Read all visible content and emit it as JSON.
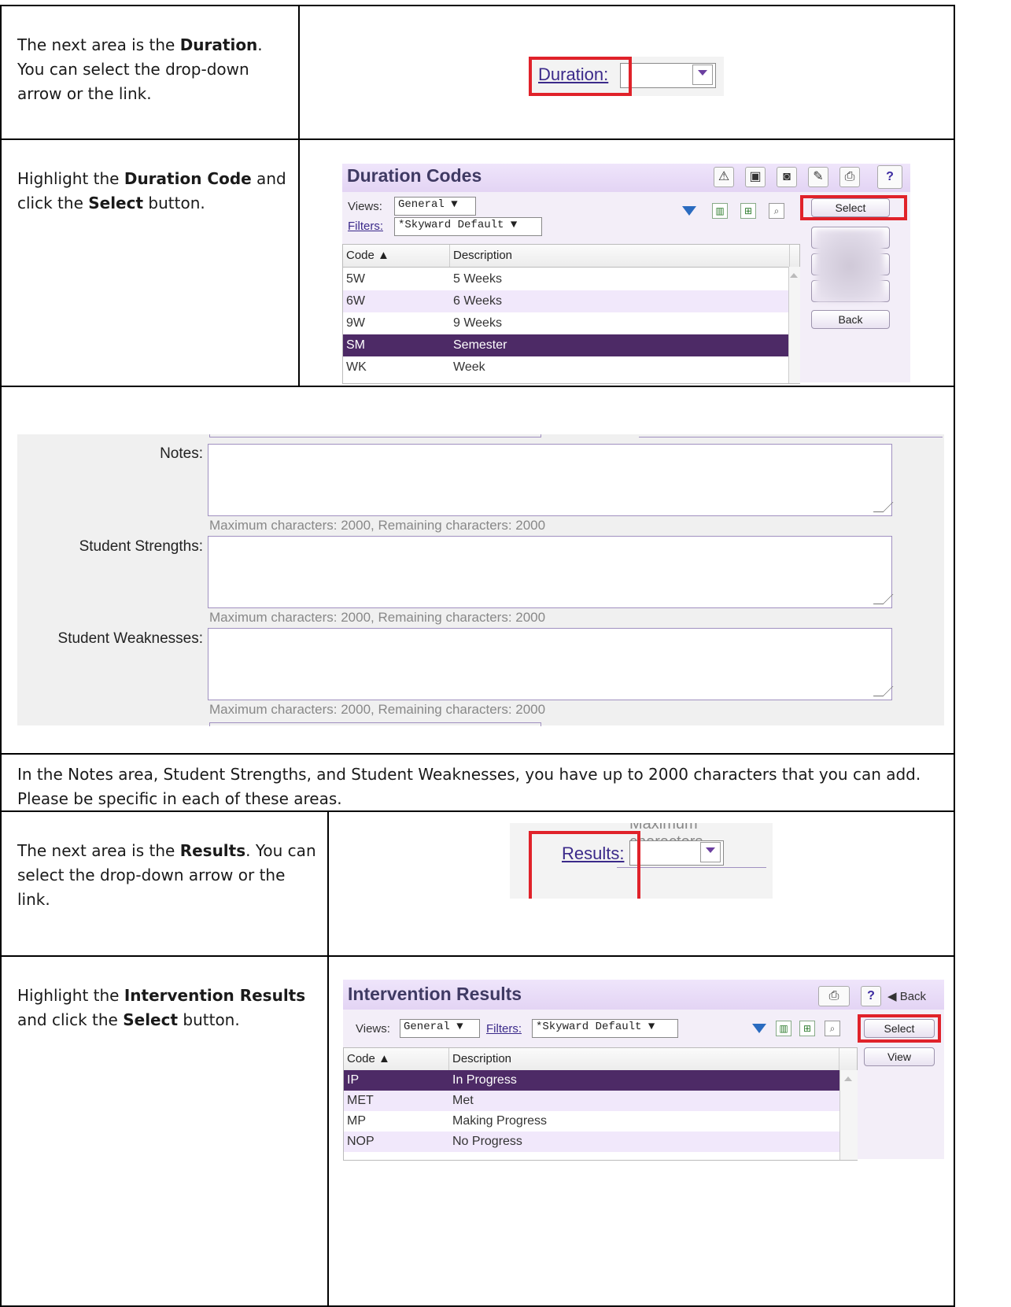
{
  "rows": {
    "duration_intro": {
      "parts": [
        "The next area is the ",
        "Duration",
        ". You can select the drop-down arrow or the link."
      ]
    },
    "duration_select": {
      "parts": [
        "Highlight the ",
        "Duration Code",
        " and click the ",
        "Select",
        " button."
      ]
    },
    "notes_paragraph": "In the Notes area, Student Strengths, and Student Weaknesses, you have up to 2000 characters that you can add.  Please be specific in each of these areas.",
    "results_intro": {
      "parts": [
        "The next area is the ",
        "Results",
        ".  You can select the drop-down arrow or the link."
      ]
    },
    "results_select": {
      "parts": [
        "Highlight the ",
        "Intervention Results",
        " and click the ",
        "Select",
        " button."
      ]
    }
  },
  "duration_field": {
    "label": "Duration:"
  },
  "duration_codes": {
    "title": "Duration Codes",
    "views_label": "Views:",
    "views_value": "General ▼",
    "filters_label": "Filters:",
    "filters_value": "*Skyward Default ▼",
    "select_button": "Select",
    "back_button": "Back",
    "columns": [
      "Code ▲",
      "Description"
    ],
    "rows": [
      {
        "code": "5W",
        "desc": "5 Weeks"
      },
      {
        "code": "6W",
        "desc": "6 Weeks"
      },
      {
        "code": "9W",
        "desc": "9 Weeks"
      },
      {
        "code": "SM",
        "desc": "Semester"
      },
      {
        "code": "WK",
        "desc": "Week"
      }
    ],
    "help": "?"
  },
  "notes_form": {
    "fields": [
      {
        "label": "Notes:",
        "hint": "Maximum characters: 2000, Remaining characters: 2000"
      },
      {
        "label": "Student Strengths:",
        "hint": "Maximum characters: 2000, Remaining characters: 2000"
      },
      {
        "label": "Student Weaknesses:",
        "hint": "Maximum characters: 2000, Remaining characters: 2000"
      }
    ]
  },
  "results_field": {
    "label": "Results:",
    "cutoff_text": "Maximum characters"
  },
  "intervention_results": {
    "title": "Intervention Results",
    "views_label": "Views:",
    "views_value": "General ▼",
    "filters_label": "Filters:",
    "filters_value": "*Skyward Default ▼",
    "select_button": "Select",
    "view_button": "View",
    "back_link": "◀ Back",
    "help": "?",
    "columns": [
      "Code ▲",
      "Description"
    ],
    "rows": [
      {
        "code": "IP",
        "desc": "In Progress"
      },
      {
        "code": "MET",
        "desc": "Met"
      },
      {
        "code": "MP",
        "desc": "Making Progress"
      },
      {
        "code": "NOP",
        "desc": "No Progress"
      }
    ]
  }
}
